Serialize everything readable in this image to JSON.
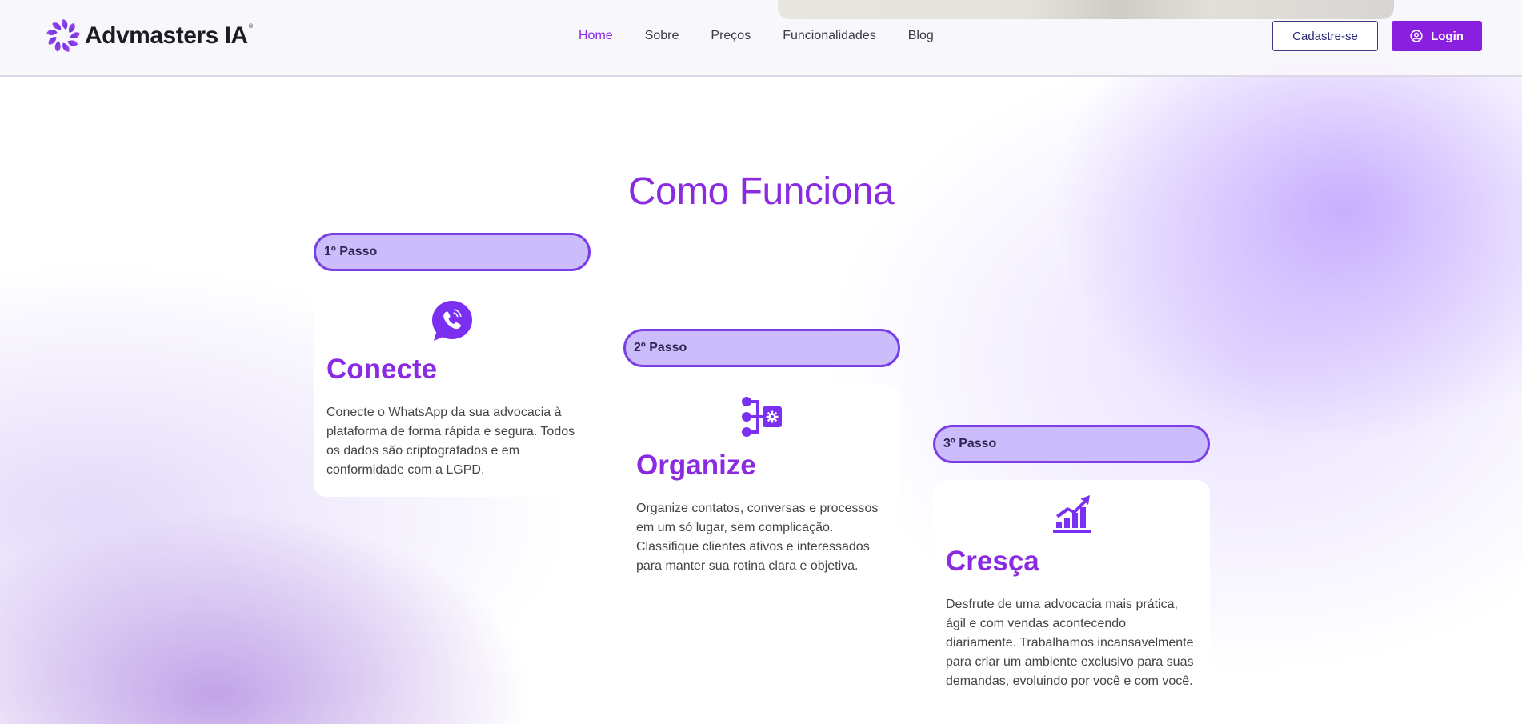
{
  "brand": {
    "name": "Advmasters IA",
    "trademark": "®"
  },
  "nav": {
    "items": [
      {
        "label": "Home",
        "active": true
      },
      {
        "label": "Sobre",
        "active": false
      },
      {
        "label": "Preços",
        "active": false
      },
      {
        "label": "Funcionalidades",
        "active": false
      },
      {
        "label": "Blog",
        "active": false
      }
    ],
    "signup_label": "Cadastre-se",
    "login_label": "Login"
  },
  "section": {
    "title": "Como Funciona",
    "steps": [
      {
        "step_label": "1º Passo",
        "icon": "whatsapp-icon",
        "title": "Conecte",
        "text": "Conecte o WhatsApp da sua advocacia à plataforma de forma rápida e segura. Todos os dados são criptografados e em conformidade com a LGPD."
      },
      {
        "step_label": "2º Passo",
        "icon": "workflow-icon",
        "title": "Organize",
        "text": "Organize contatos, conversas e processos em um só lugar, sem complicação. Classifique clientes ativos e interessados para manter sua rotina clara e objetiva."
      },
      {
        "step_label": "3º Passo",
        "icon": "growth-chart-icon",
        "title": "Cresça",
        "text": "Desfrute de uma advocacia mais prática, ágil e com vendas acontecendo diariamente. Trabalhamos incansavelmente para criar um ambiente exclusivo para suas demandas, evoluindo por você e com você."
      }
    ]
  },
  "colors": {
    "accent": "#8a2be2",
    "pill_bg": "#cbbdfb",
    "pill_border": "#7b3fe8",
    "login_bg": "#8a1fe0"
  }
}
